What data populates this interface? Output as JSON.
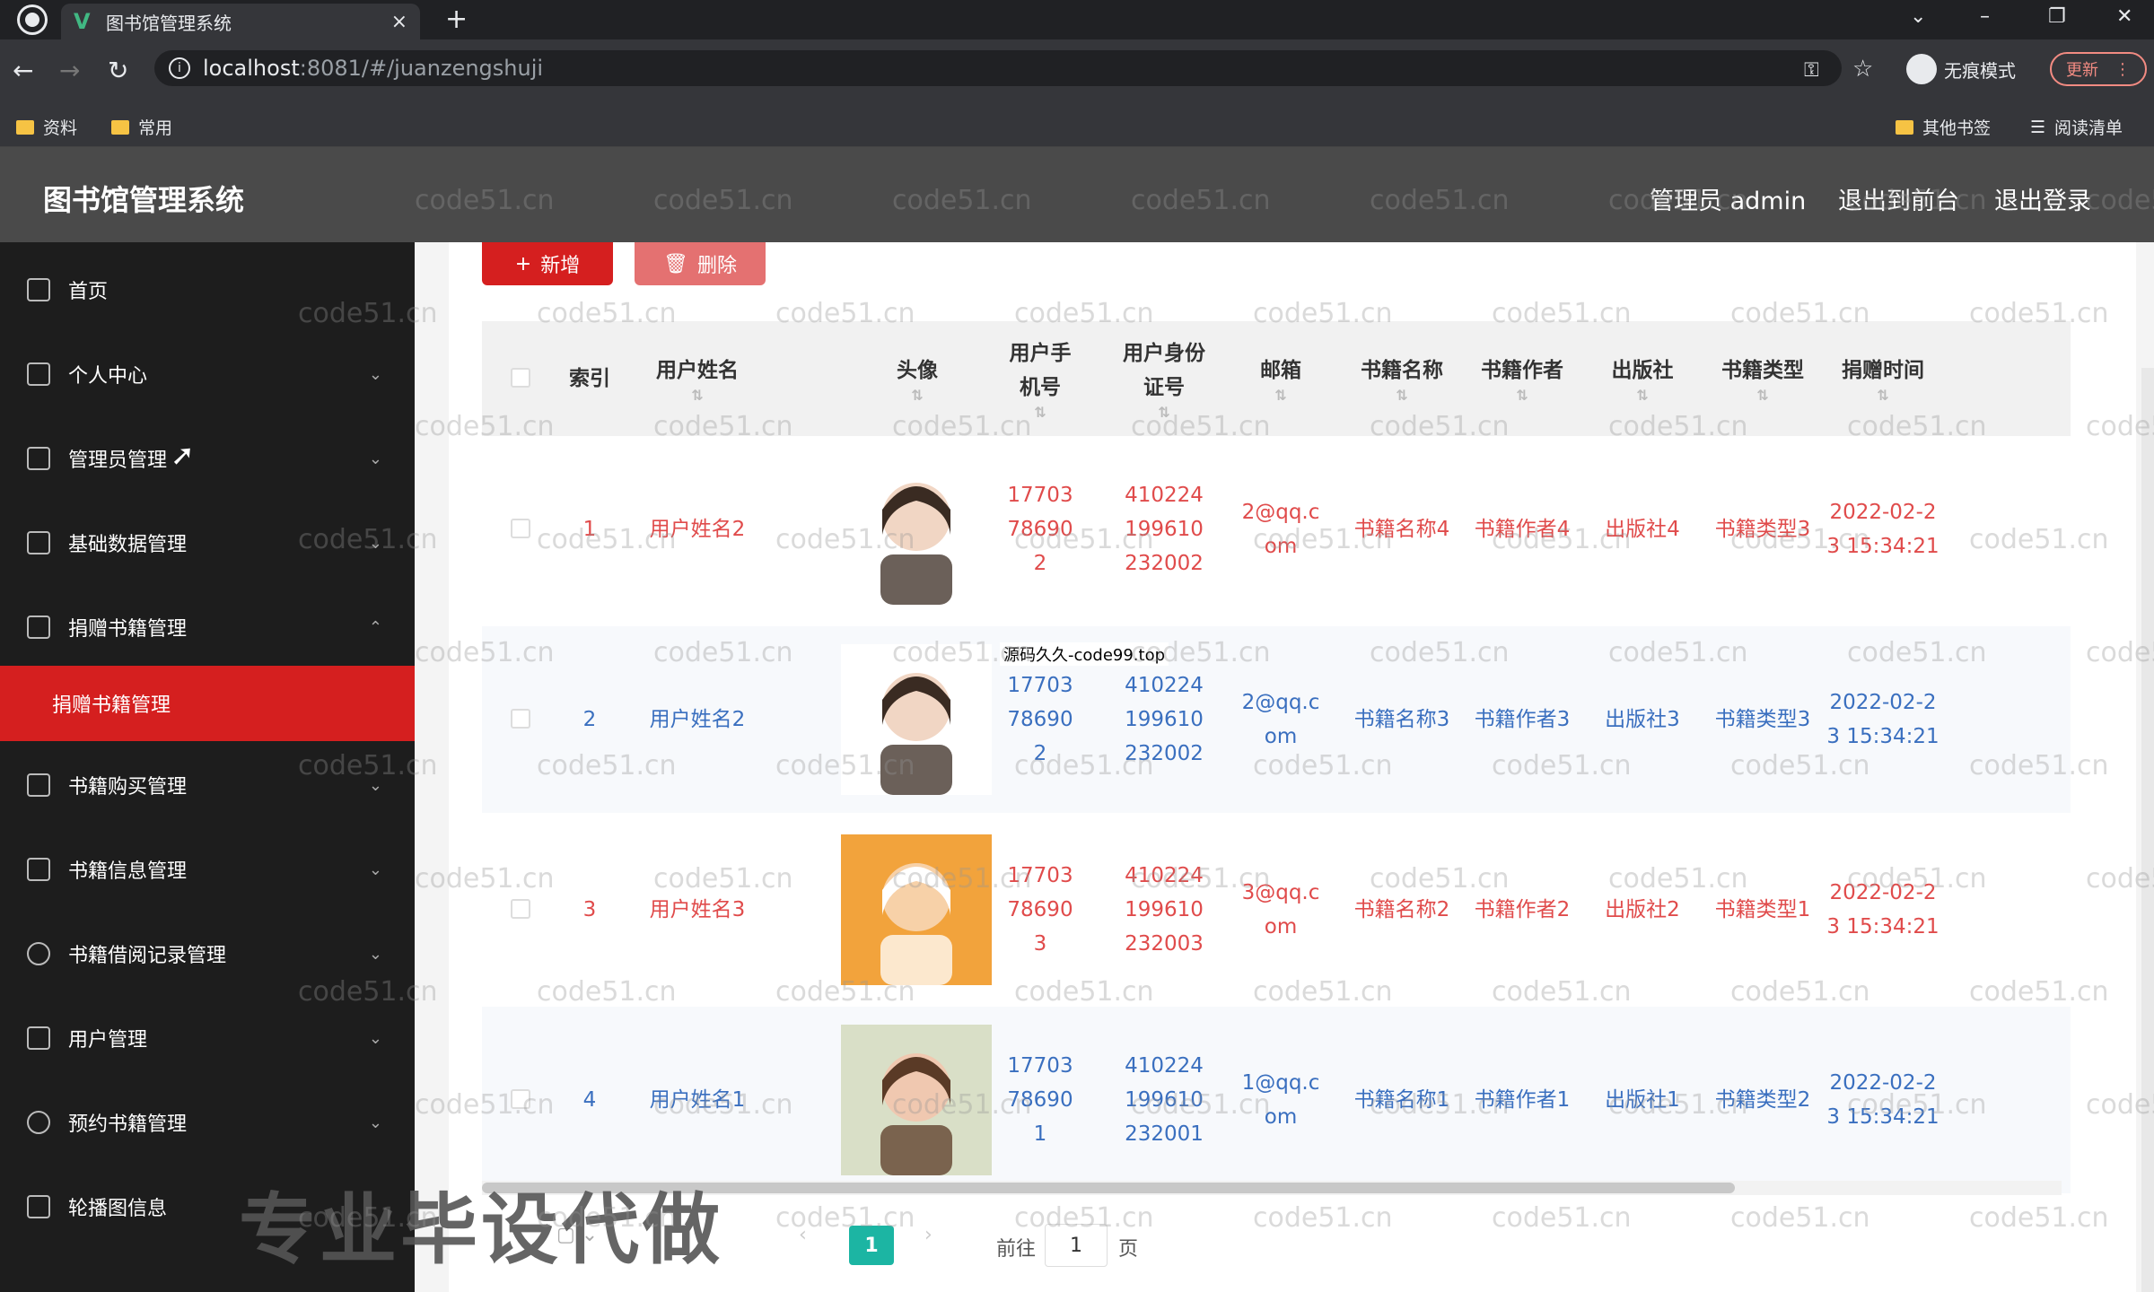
{
  "browser": {
    "tab_title": "图书馆管理系统",
    "close_glyph": "×",
    "new_tab_glyph": "+",
    "url_host": "localhost",
    "url_rest": ":8081/#/juanzengshuji",
    "incognito_label": "无痕模式",
    "update_label": "更新",
    "bookmarks": [
      "资料",
      "常用"
    ],
    "other_bookmarks": "其他书签",
    "reading_list": "阅读清单"
  },
  "header": {
    "title": "图书馆管理系统",
    "admin": "管理员 admin",
    "to_front": "退出到前台",
    "logout": "退出登录"
  },
  "sidebar": {
    "items": [
      {
        "label": "首页",
        "icon": "home-icon"
      },
      {
        "label": "个人中心",
        "icon": "user-icon"
      },
      {
        "label": "管理员管理",
        "icon": "mic-icon"
      },
      {
        "label": "基础数据管理",
        "icon": "sliders-icon"
      },
      {
        "label": "捐赠书籍管理",
        "icon": "copy-icon"
      },
      {
        "label": "捐赠书籍管理",
        "icon": ""
      },
      {
        "label": "书籍购买管理",
        "icon": "card-icon"
      },
      {
        "label": "书籍信息管理",
        "icon": "delete-box-icon"
      },
      {
        "label": "书籍借阅记录管理",
        "icon": "clock-icon"
      },
      {
        "label": "用户管理",
        "icon": "grid-icon"
      },
      {
        "label": "预约书籍管理",
        "icon": "compass-icon"
      },
      {
        "label": "轮播图信息",
        "icon": "apps-icon"
      }
    ]
  },
  "toolbar": {
    "add": "新增",
    "delete": "删除"
  },
  "table": {
    "headers": [
      "索引",
      "用户姓名",
      "头像",
      "用户手机号",
      "用户身份证号",
      "邮箱",
      "书籍名称",
      "书籍作者",
      "出版社",
      "书籍类型",
      "捐赠时间"
    ],
    "rows": [
      {
        "index": "1",
        "name": "用户姓名2",
        "phone": "17703786902",
        "id": "410224199610232002",
        "email": "2@qq.com",
        "book": "书籍名称4",
        "author": "书籍作者4",
        "pub": "出版社4",
        "type": "书籍类型3",
        "time": "2022-02-23 15:34:21"
      },
      {
        "index": "2",
        "name": "用户姓名2",
        "phone": "17703786902",
        "id": "410224199610232002",
        "email": "2@qq.com",
        "book": "书籍名称3",
        "author": "书籍作者3",
        "pub": "出版社3",
        "type": "书籍类型3",
        "time": "2022-02-23 15:34:21"
      },
      {
        "index": "3",
        "name": "用户姓名3",
        "phone": "17703786903",
        "id": "410224199610232003",
        "email": "3@qq.com",
        "book": "书籍名称2",
        "author": "书籍作者2",
        "pub": "出版社2",
        "type": "书籍类型1",
        "time": "2022-02-23 15:34:21"
      },
      {
        "index": "4",
        "name": "用户姓名1",
        "phone": "17703786901",
        "id": "410224199610232001",
        "email": "1@qq.com",
        "book": "书籍名称1",
        "author": "书籍作者1",
        "pub": "出版社1",
        "type": "书籍类型2",
        "time": "2022-02-23 15:34:21"
      }
    ]
  },
  "pager": {
    "current": "1",
    "goto_prefix": "前往",
    "goto_value": "1",
    "goto_suffix": "页"
  },
  "overlay_text": "专业毕设代做",
  "watermark_note": "源码久久-code99.top",
  "watermark": "code51.cn"
}
